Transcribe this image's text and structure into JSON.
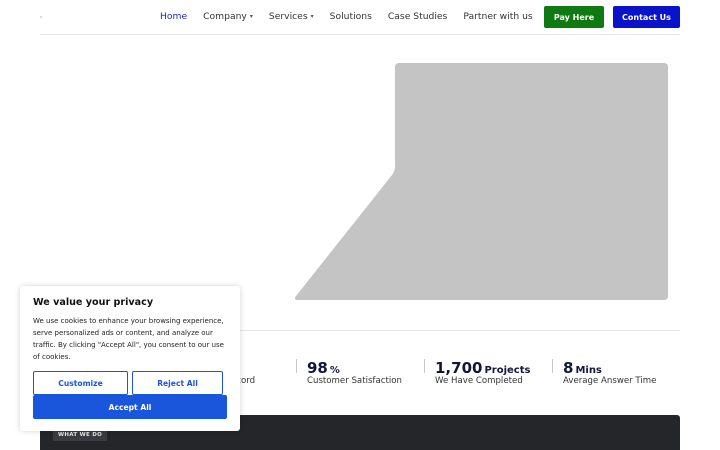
{
  "nav": {
    "items": [
      {
        "label": "Home",
        "has_dropdown": false,
        "active": true
      },
      {
        "label": "Company",
        "has_dropdown": true,
        "active": false
      },
      {
        "label": "Services",
        "has_dropdown": true,
        "active": false
      },
      {
        "label": "Solutions",
        "has_dropdown": false,
        "active": false
      },
      {
        "label": "Case Studies",
        "has_dropdown": false,
        "active": false
      },
      {
        "label": "Partner with us",
        "has_dropdown": false,
        "active": false
      }
    ],
    "caret_icon": "▾",
    "pay_label": "Pay Here",
    "contact_label": "Contact Us"
  },
  "colors": {
    "active_nav": "#1b2aa6",
    "pay_button": "#0f7a12",
    "contact_button": "#0a13c9",
    "accept_button": "#1a56db",
    "hero_placeholder": "#c4c4c4",
    "dark_section": "#25262a"
  },
  "stats": {
    "partial_label": "ecord",
    "items": [
      {
        "value": "98",
        "unit": "%",
        "label": "Customer Satisfaction"
      },
      {
        "value": "1,700",
        "unit": "Projects",
        "label": "We Have Completed"
      },
      {
        "value": "8",
        "unit": "Mins",
        "label": "Average Answer Time"
      }
    ]
  },
  "section": {
    "tag": "WHAT WE DO"
  },
  "cookie": {
    "title": "We value your privacy",
    "text": "We use cookies to enhance your browsing experience, serve personalized ads or content, and analyze our traffic. By clicking \"Accept All\", you consent to our use of cookies.",
    "customize_label": "Customize",
    "reject_label": "Reject All",
    "accept_label": "Accept All"
  }
}
